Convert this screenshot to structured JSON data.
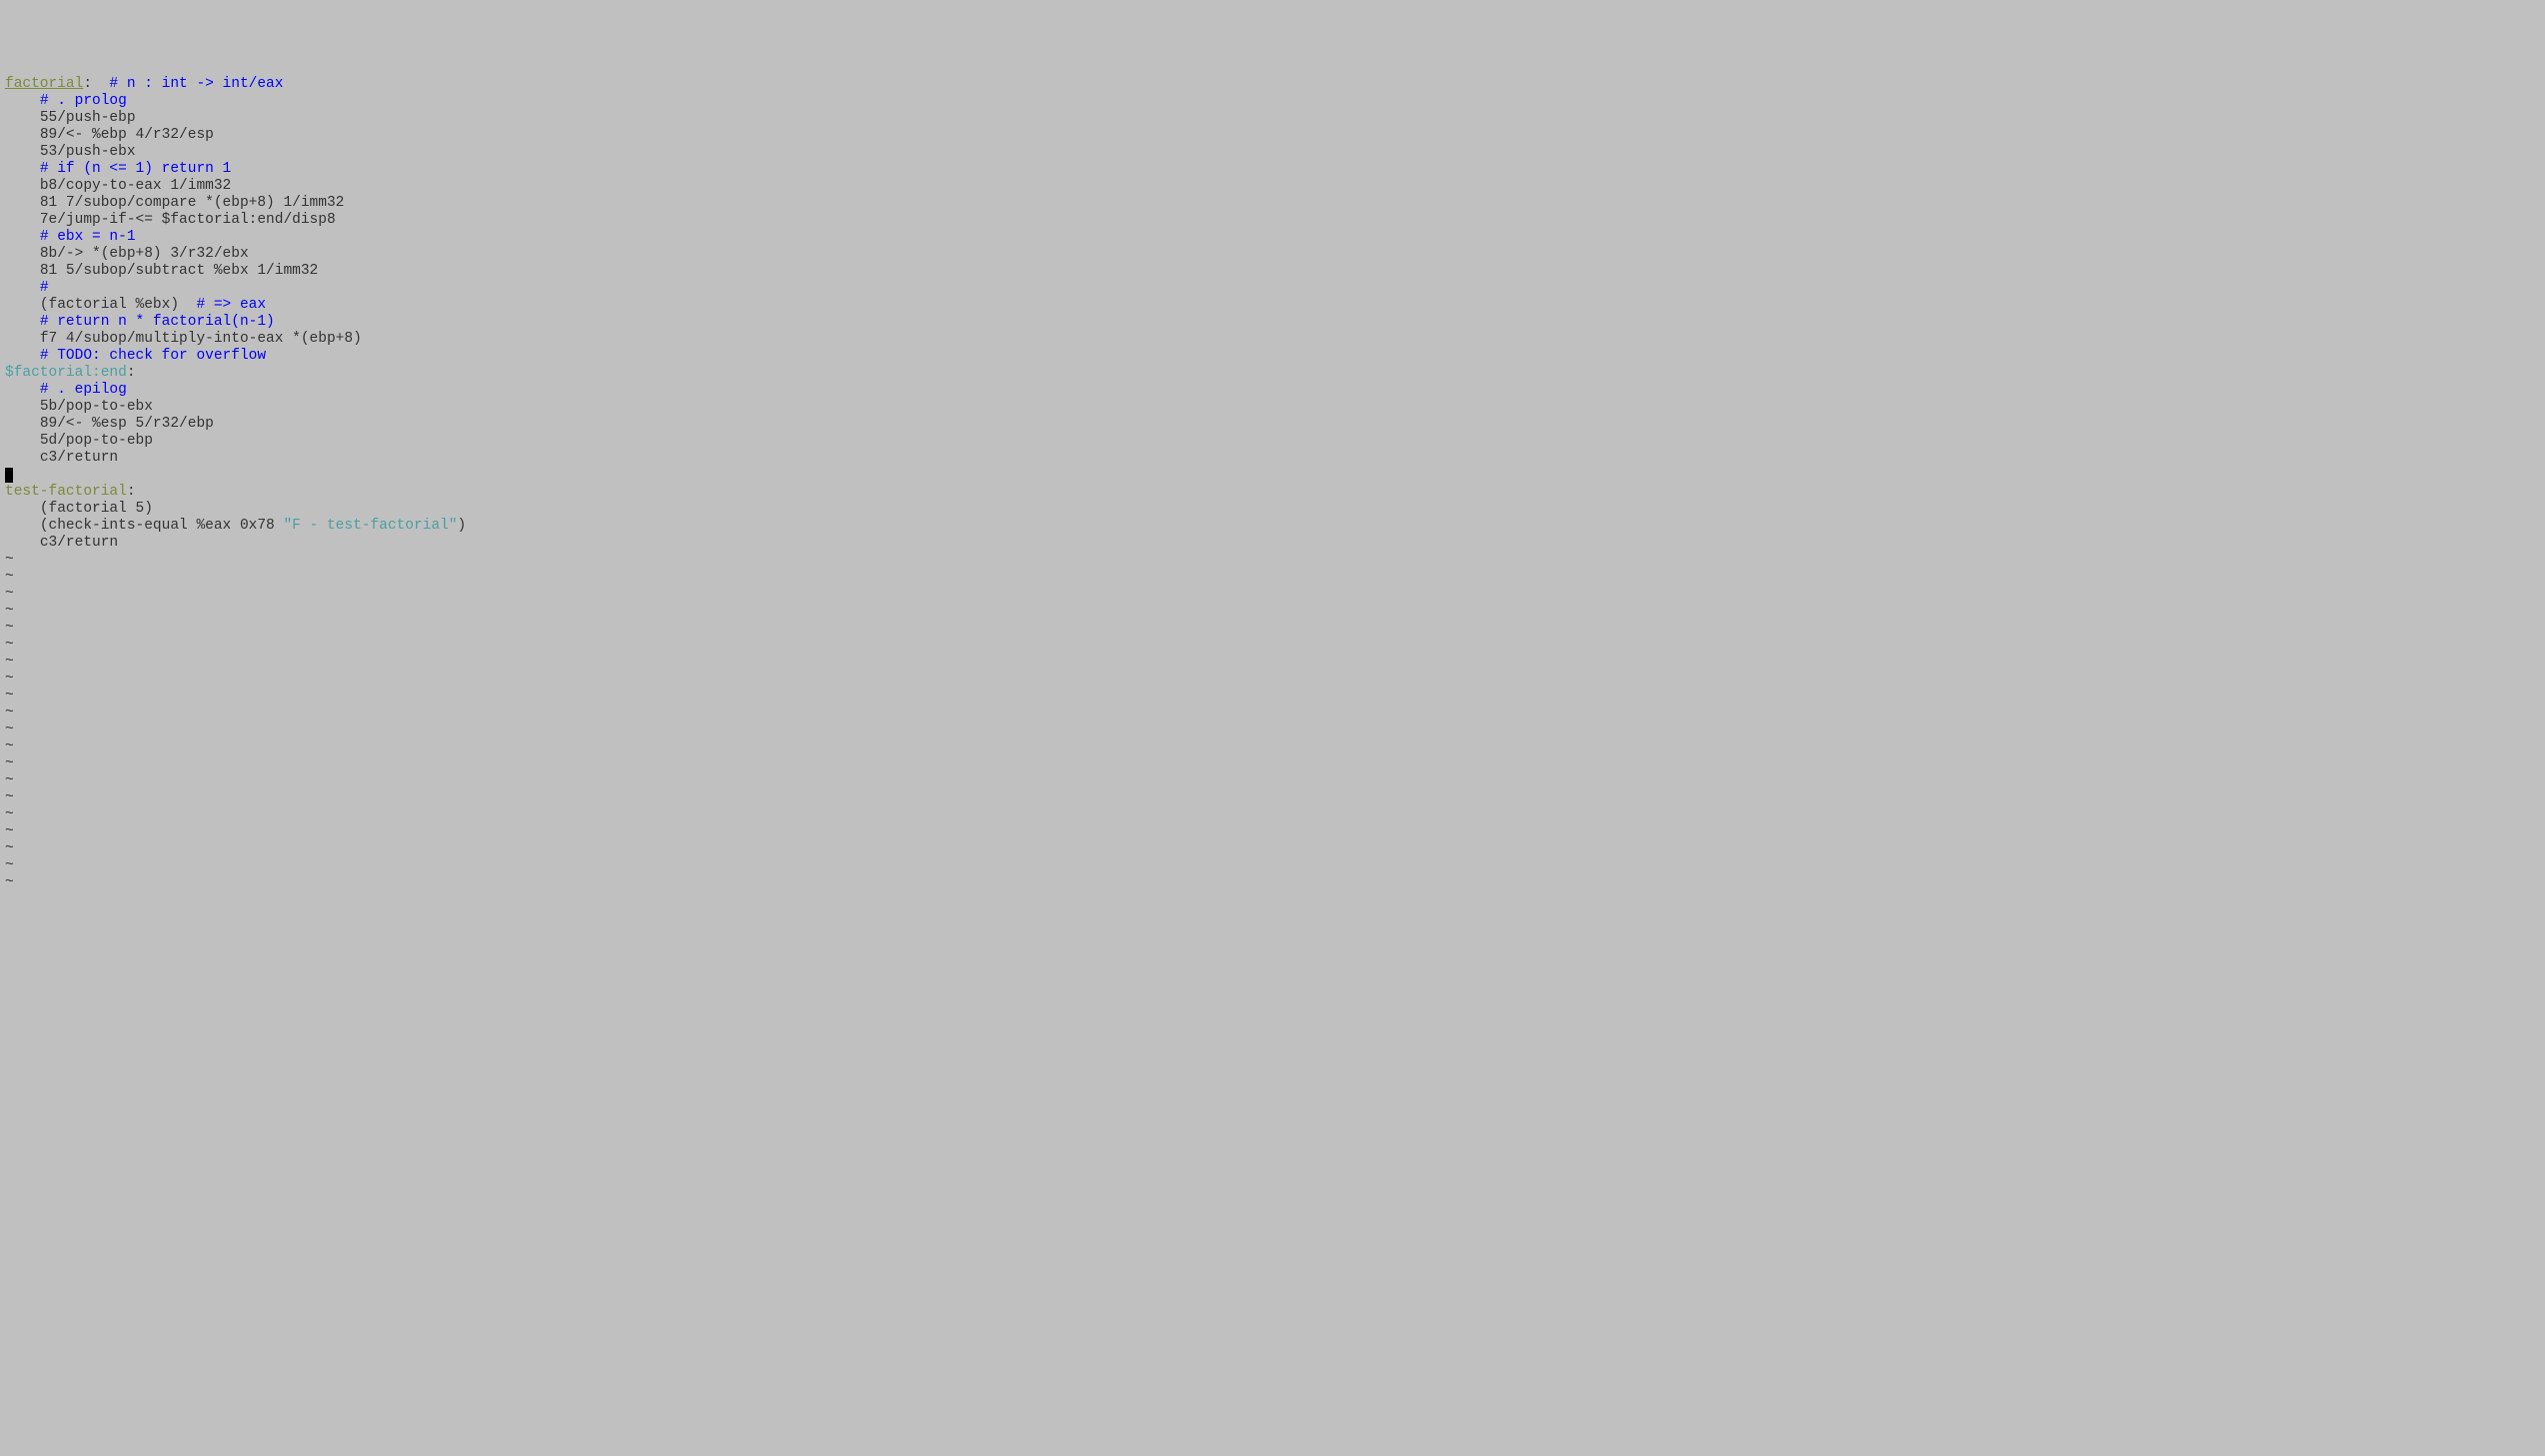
{
  "lines": {
    "l1_label": "factorial",
    "l1_colon": ":",
    "l1_comment": "  # n : int -> int/eax",
    "l2_indent": "    ",
    "l2_comment": "# . prolog",
    "l3_indent": "    ",
    "l3_code": "55/push-ebp",
    "l4_indent": "    ",
    "l4_code": "89/<- %ebp 4/r32/esp",
    "l5_indent": "    ",
    "l5_code": "53/push-ebx",
    "l6_indent": "    ",
    "l6_comment": "# if (n <= 1) return 1",
    "l7_indent": "    ",
    "l7_code": "b8/copy-to-eax 1/imm32",
    "l8_indent": "    ",
    "l8_code": "81 7/subop/compare *(ebp+8) 1/imm32",
    "l9_indent": "    ",
    "l9_code": "7e/jump-if-<= $factorial:end/disp8",
    "l10_indent": "    ",
    "l10_comment": "# ebx = n-1",
    "l11_indent": "    ",
    "l11_code": "8b/-> *(ebp+8) 3/r32/ebx",
    "l12_indent": "    ",
    "l12_code": "81 5/subop/subtract %ebx 1/imm32",
    "l13_indent": "    ",
    "l13_comment": "#",
    "l14_indent": "    ",
    "l14_code": "(factorial %ebx)  ",
    "l14_comment": "# => eax",
    "l15_indent": "    ",
    "l15_comment": "# return n * factorial(n-1)",
    "l16_indent": "    ",
    "l16_code": "f7 4/subop/multiply-into-eax *(ebp+8)",
    "l17_indent": "    ",
    "l17_comment": "# TODO: check for overflow",
    "l18_sublabel": "$factorial:end",
    "l18_colon": ":",
    "l19_indent": "    ",
    "l19_comment": "# . epilog",
    "l20_indent": "    ",
    "l20_code": "5b/pop-to-ebx",
    "l21_indent": "    ",
    "l21_code": "89/<- %esp 5/r32/ebp",
    "l22_indent": "    ",
    "l22_code": "5d/pop-to-ebp",
    "l23_indent": "    ",
    "l23_code": "c3/return",
    "l25_label": "test-factorial",
    "l25_colon": ":",
    "l26_indent": "    ",
    "l26_code": "(factorial 5)",
    "l27_indent": "    ",
    "l27_code1": "(check-ints-equal %eax 0x78 ",
    "l27_string": "\"F - test-factorial\"",
    "l27_code2": ")",
    "l28_indent": "    ",
    "l28_code": "c3/return",
    "tilde": "~"
  }
}
